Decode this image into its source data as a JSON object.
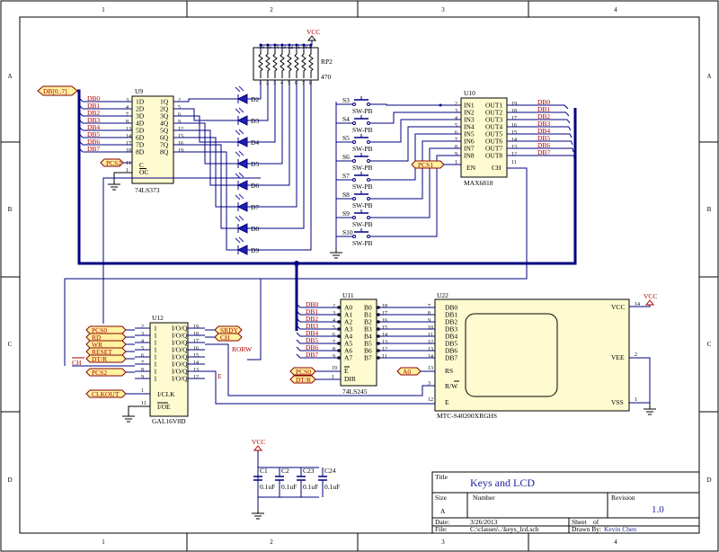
{
  "border": {
    "columns": [
      "1",
      "2",
      "3",
      "4"
    ],
    "rows": [
      "A",
      "B",
      "C",
      "D"
    ]
  },
  "power": {
    "vcc": "VCC"
  },
  "bus": {
    "db": "DB[0..7]"
  },
  "db_lines": [
    "DB0",
    "DB1",
    "DB2",
    "DB3",
    "DB4",
    "DB5",
    "DB6",
    "DB7"
  ],
  "u9": {
    "ref": "U9",
    "part": "74LS373",
    "d_pins": [
      "1D",
      "2D",
      "3D",
      "4D",
      "5D",
      "6D",
      "7D",
      "8D"
    ],
    "d_nums": [
      "3",
      "4",
      "7",
      "8",
      "13",
      "14",
      "17",
      "18"
    ],
    "q_pins": [
      "1Q",
      "2Q",
      "3Q",
      "4Q",
      "5Q",
      "6Q",
      "7Q",
      "8Q"
    ],
    "q_nums": [
      "2",
      "5",
      "6",
      "9",
      "12",
      "15",
      "16",
      "19"
    ],
    "c_pin": "C",
    "oc_pin": "OC",
    "c_num": "11",
    "oc_num": "1",
    "cs": "PCS2"
  },
  "leds": [
    "D2",
    "D3",
    "D4",
    "D5",
    "D6",
    "D7",
    "D8",
    "D9"
  ],
  "rp2": {
    "ref": "RP2",
    "value": "470",
    "top_pins": [
      "16",
      "15",
      "14",
      "13",
      "12",
      "11",
      "10",
      "9"
    ],
    "bottom_pins": [
      "1",
      "2",
      "3",
      "4",
      "5",
      "6",
      "7",
      "8"
    ]
  },
  "switches": {
    "refs": [
      "S3",
      "S4",
      "S5",
      "S6",
      "S7",
      "S8",
      "S9",
      "S10"
    ],
    "type": "SW-PB"
  },
  "u10": {
    "ref": "U10",
    "part": "MAX6818",
    "in_pins": [
      "IN1",
      "IN2",
      "IN3",
      "IN4",
      "IN5",
      "IN6",
      "IN7",
      "IN8"
    ],
    "in_nums": [
      "2",
      "3",
      "4",
      "5",
      "6",
      "7",
      "8",
      "9"
    ],
    "out_pins": [
      "OUT1",
      "OUT2",
      "OUT3",
      "OUT4",
      "OUT5",
      "OUT6",
      "OUT7",
      "OUT8"
    ],
    "out_nums": [
      "19",
      "18",
      "17",
      "16",
      "15",
      "14",
      "13",
      "12"
    ],
    "en": "EN",
    "ch": "CH",
    "en_num": "1",
    "ch_num": "11",
    "cs": "PCS1"
  },
  "u11": {
    "ref": "U11",
    "part": "74LS245",
    "a_pins": [
      "A0",
      "A1",
      "A2",
      "A3",
      "A4",
      "A5",
      "A6",
      "A7"
    ],
    "a_nums": [
      "2",
      "3",
      "4",
      "5",
      "6",
      "7",
      "8",
      "9"
    ],
    "b_pins": [
      "B0",
      "B1",
      "B2",
      "B3",
      "B4",
      "B5",
      "B6",
      "B7"
    ],
    "b_nums": [
      "18",
      "17",
      "16",
      "15",
      "14",
      "13",
      "12",
      "11"
    ],
    "e": "E",
    "dir": "DIR",
    "e_num": "19",
    "dir_num": "1",
    "ports": [
      "PCS0",
      "DT/R"
    ]
  },
  "u12": {
    "ref": "U12",
    "part": "GAL16V8D",
    "left_nums": [
      "2",
      "3",
      "4",
      "5",
      "6",
      "7",
      "8",
      "9"
    ],
    "right_nums": [
      "19",
      "18",
      "17",
      "16",
      "15",
      "14",
      "13",
      "12"
    ],
    "right_pins": [
      "I/O/Q",
      "I/O/Q",
      "I/O/Q",
      "I/O/Q",
      "I/O/Q",
      "I/O/Q",
      "I/O/Q",
      "I/O/Q"
    ],
    "left_pins": [
      "1",
      "1",
      "1",
      "1",
      "1",
      "1",
      "1",
      "1"
    ],
    "clk": "I/CLK",
    "oe": "I/OE",
    "clk_num": "1",
    "oe_num": "11",
    "in_ports": [
      "PCS0",
      "RD",
      "WR",
      "RESET",
      "DT/R"
    ],
    "ch_label": "CH",
    "pcs2": "PCS2",
    "clkout": "CLKOUT",
    "out_ports": [
      "SRDY",
      "CH"
    ],
    "rorw": "RORW",
    "e_label": "E"
  },
  "u22": {
    "ref": "U22",
    "part": "MTC-S40200XRGHS",
    "db_pins": [
      "DB0",
      "DB1",
      "DB2",
      "DB3",
      "DB4",
      "DB5",
      "DB6",
      "DB7"
    ],
    "db_nums": [
      "7",
      "8",
      "9",
      "10",
      "11",
      "12",
      "13",
      "14"
    ],
    "rs": "RS",
    "rw": "R/W",
    "e": "E",
    "rs_num": "13",
    "rw_num": "3",
    "e_num": "12",
    "vcc": "VCC",
    "vee": "VEE",
    "vss": "VSS",
    "vcc_num": "14",
    "vee_num": "2",
    "vss_num": "1",
    "a0": "A0"
  },
  "caps": {
    "refs": [
      "C1",
      "C2",
      "C23",
      "C24"
    ],
    "values": [
      "0.1uF",
      "0.1uF",
      "0.1uF",
      "0.1uF"
    ]
  },
  "title_block": {
    "title_label": "Title",
    "title": "Keys and LCD",
    "size_label": "Size",
    "size": "A",
    "number_label": "Number",
    "revision_label": "Revision",
    "revision": "1.0",
    "date_label": "Date:",
    "date": "3/26/2013",
    "sheet_label": "Sheet",
    "sheet_of": "of",
    "file_label": "File:",
    "file": "C:\\classes\\..\\keys_lcd.sch",
    "drawn_label": "Drawn By:",
    "drawn": "Kevin Chen"
  }
}
